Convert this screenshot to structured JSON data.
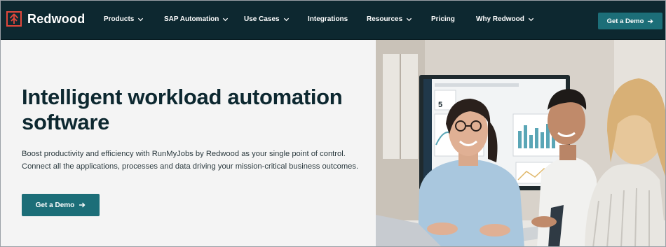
{
  "brand": {
    "name": "Redwood",
    "accent": "#e2473b",
    "nav_bg": "#0d2830",
    "button_bg": "#1c6e78"
  },
  "nav": {
    "items": [
      {
        "label": "Products",
        "dropdown": true
      },
      {
        "label": "SAP Automation",
        "dropdown": true
      },
      {
        "label": "Use Cases",
        "dropdown": true
      },
      {
        "label": "Integrations",
        "dropdown": false
      },
      {
        "label": "Resources",
        "dropdown": true
      },
      {
        "label": "Pricing",
        "dropdown": false
      },
      {
        "label": "Why Redwood",
        "dropdown": true
      }
    ],
    "cta_label": "Get a Demo"
  },
  "hero": {
    "headline": "Intelligent workload automation software",
    "subtext": "Boost productivity and efficiency with RunMyJobs by Redwood as your single point of control. Connect all the applications, processes and data driving your mission-critical business outcomes.",
    "cta_label": "Get a Demo"
  },
  "photo": {
    "dashboard_value": "5"
  }
}
